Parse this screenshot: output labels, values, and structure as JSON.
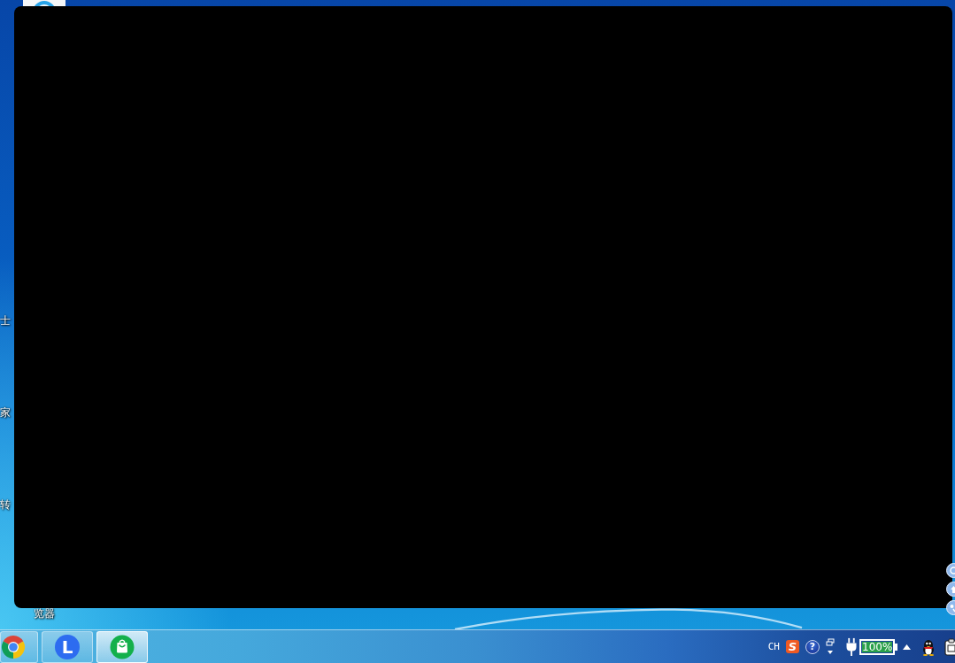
{
  "desktop": {
    "icon_labels": [
      {
        "label": "士"
      },
      {
        "label": "家"
      },
      {
        "label": "转"
      },
      {
        "label": "览器"
      }
    ]
  },
  "taskbar": {
    "apps": [
      {
        "kind": "chrome",
        "selected": false
      },
      {
        "kind": "letter",
        "glyph": "L",
        "selected": false
      },
      {
        "kind": "bag",
        "selected": true
      }
    ],
    "tray": {
      "language": "CH",
      "ime_logo": "S",
      "help": "?",
      "battery": "100%"
    }
  }
}
